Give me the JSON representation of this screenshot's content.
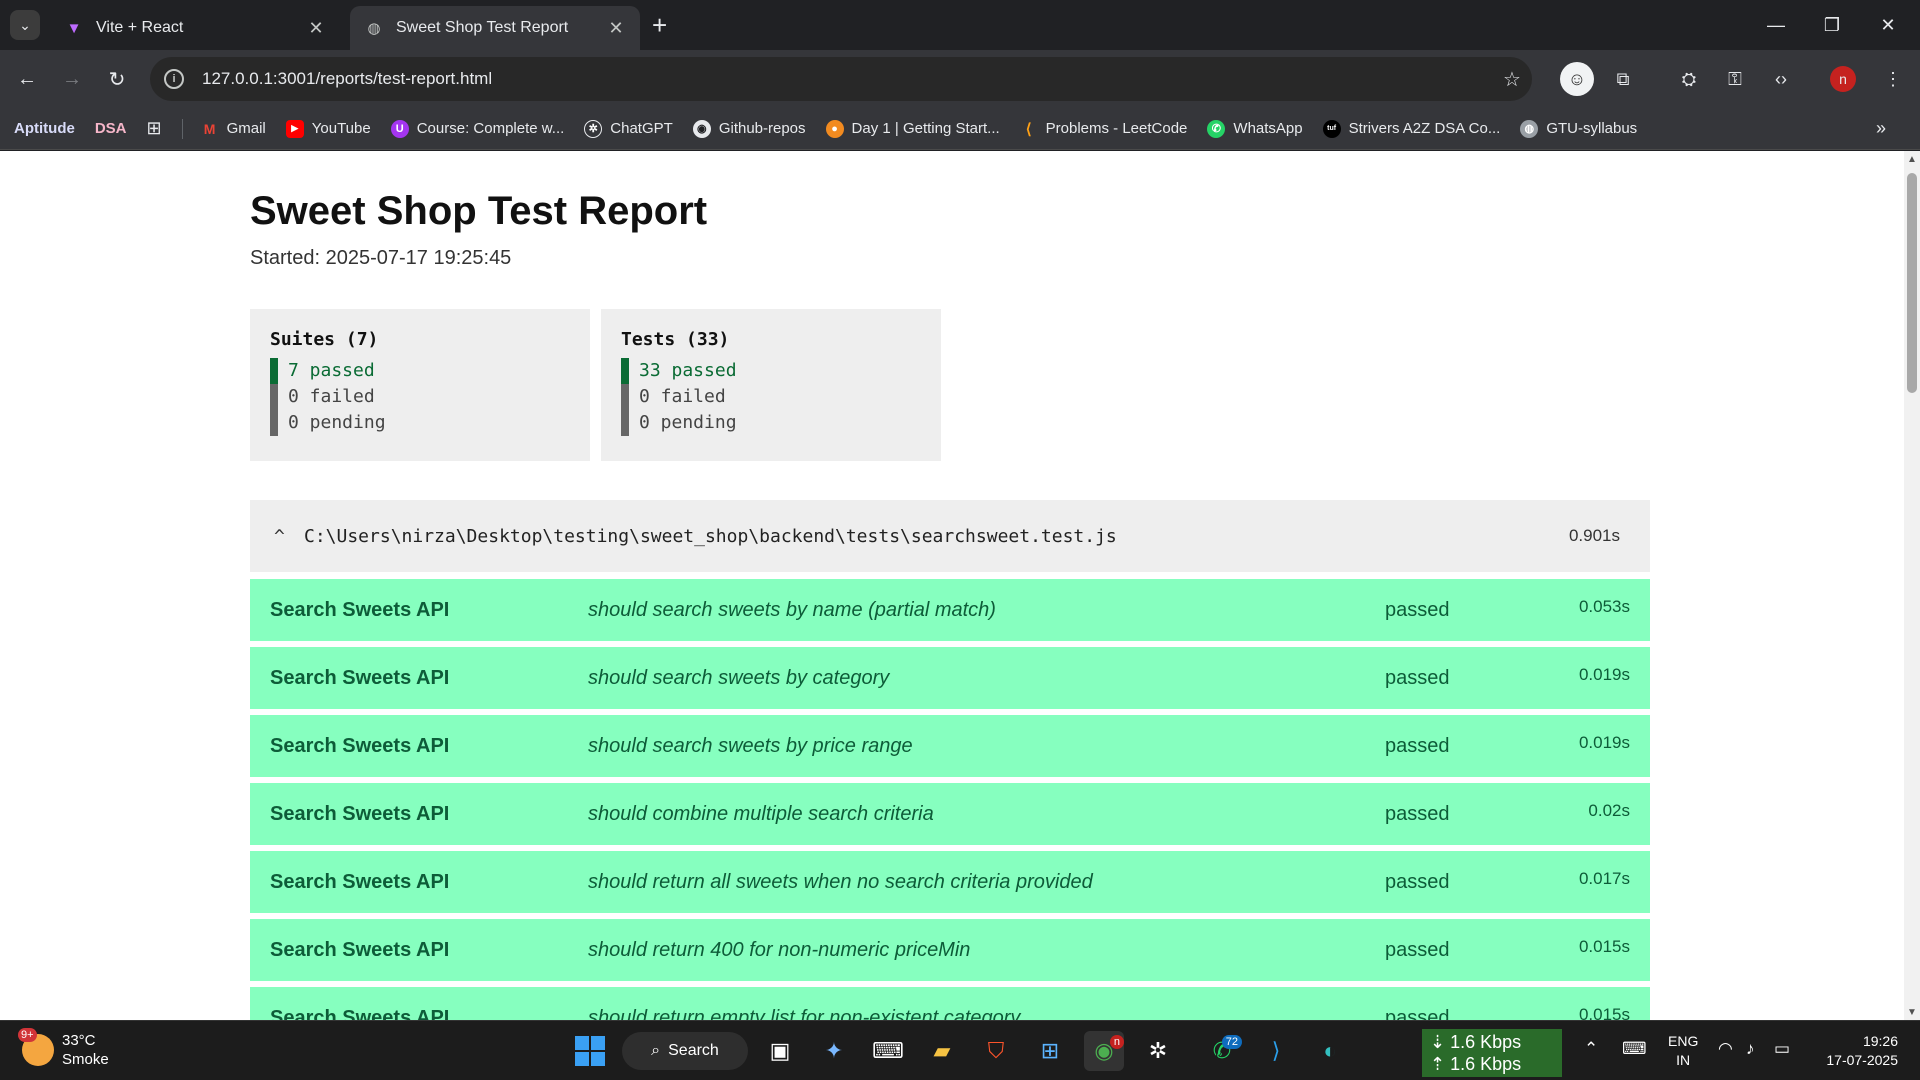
{
  "browser": {
    "tabs": [
      {
        "title": "Vite + React",
        "active": false
      },
      {
        "title": "Sweet Shop Test Report",
        "active": true
      }
    ],
    "new_tab": "+",
    "url": "127.0.0.1:3001/reports/test-report.html",
    "profile_initial": "n",
    "bookmarks": {
      "chips": [
        "Aptitude",
        "DSA"
      ],
      "items": [
        "Gmail",
        "YouTube",
        "Course: Complete w...",
        "ChatGPT",
        "Github-repos",
        "Day 1 | Getting Start...",
        "Problems - LeetCode",
        "WhatsApp",
        "Strivers A2Z DSA Co...",
        "GTU-syllabus"
      ]
    }
  },
  "report": {
    "title": "Sweet Shop Test Report",
    "started": "Started: 2025-07-17 19:25:45",
    "suites": {
      "header": "Suites (7)",
      "passed": "7 passed",
      "failed": "0 failed",
      "pending": "0 pending"
    },
    "tests_summary": {
      "header": "Tests (33)",
      "passed": "33 passed",
      "failed": "0 failed",
      "pending": "0 pending"
    },
    "file": {
      "caret": "^",
      "path": "C:\\Users\\nirza\\Desktop\\testing\\sweet_shop\\backend\\tests\\searchsweet.test.js",
      "time": "0.901s"
    },
    "tests": [
      {
        "suite": "Search Sweets API",
        "name": "should search sweets by name (partial match)",
        "status": "passed",
        "duration": "0.053s"
      },
      {
        "suite": "Search Sweets API",
        "name": "should search sweets by category",
        "status": "passed",
        "duration": "0.019s"
      },
      {
        "suite": "Search Sweets API",
        "name": "should search sweets by price range",
        "status": "passed",
        "duration": "0.019s"
      },
      {
        "suite": "Search Sweets API",
        "name": "should combine multiple search criteria",
        "status": "passed",
        "duration": "0.02s"
      },
      {
        "suite": "Search Sweets API",
        "name": "should return all sweets when no search criteria provided",
        "status": "passed",
        "duration": "0.017s"
      },
      {
        "suite": "Search Sweets API",
        "name": "should return 400 for non-numeric priceMin",
        "status": "passed",
        "duration": "0.015s"
      },
      {
        "suite": "Search Sweets API",
        "name": "should return empty list for non-existent category",
        "status": "passed",
        "duration": "0.015s"
      }
    ]
  },
  "taskbar": {
    "weather_temp": "33°C",
    "weather_desc": "Smoke",
    "weather_badge": "9+",
    "search_label": "Search",
    "whatsapp_badge": "72",
    "chrome_badge": "n",
    "net_down": "⇣ 1.6 Kbps",
    "net_up": "⇡ 1.6 Kbps",
    "lang_line1": "ENG",
    "lang_line2": "IN",
    "time": "19:26",
    "date": "17-07-2025"
  },
  "colors": {
    "passed_row": "#86ffbf",
    "passed_text": "#0d5c38",
    "passed_bar": "#0a6b34",
    "summary_bg": "#eeeeee"
  }
}
